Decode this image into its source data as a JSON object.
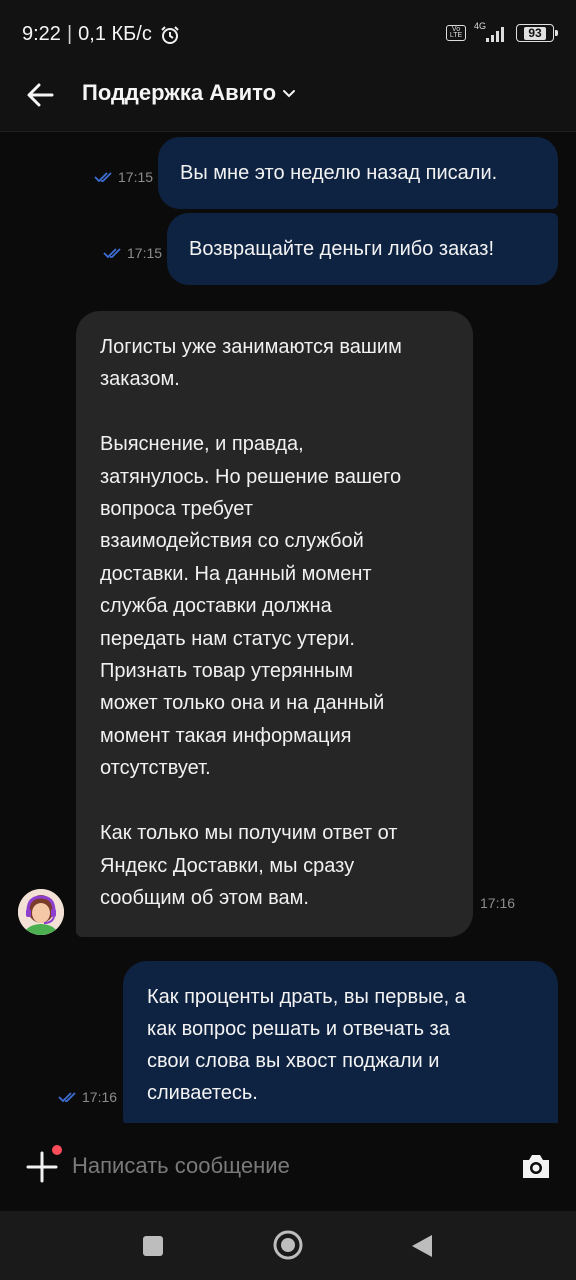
{
  "status_bar": {
    "time": "9:22",
    "speed": "0,1 КБ/с",
    "network": "4G",
    "battery": "93",
    "icons": [
      "alarm-icon",
      "volte-icon",
      "signal-icon",
      "battery-icon"
    ]
  },
  "header": {
    "title": "Поддержка Авито",
    "icons": [
      "back-arrow-icon",
      "chevron-down-icon"
    ]
  },
  "messages": [
    {
      "direction": "out",
      "text": "Вы мне это неделю назад писали.",
      "time": "17:15",
      "status": "read"
    },
    {
      "direction": "out",
      "text": "Возвращайте деньги либо заказ!",
      "time": "17:15",
      "status": "read"
    },
    {
      "direction": "in",
      "text": "Логисты уже занимаются вашим\nзаказом.\n\nВыяснение, и правда,\nзатянулось. Но решение вашего\nвопроса требует\nвзаимодействия со службой\nдоставки. На данный момент\nслужба доставки должна\nпередать нам статус утери.\nПризнать товар утерянным\nможет только она и на данный\nмомент такая информация\nотсутствует.\n\nКак только мы получим ответ от\nЯндекс Доставки, мы сразу\nсообщим об этом вам.",
      "time": "17:16"
    },
    {
      "direction": "out",
      "text": "Как проценты драть, вы первые, а\nкак вопрос решать и отвечать за\nсвои слова вы хвост поджали и\nсливаетесь.",
      "time": "17:16",
      "status": "read"
    }
  ],
  "composer": {
    "placeholder": "Написать сообщение",
    "value": "",
    "icons": [
      "plus-icon",
      "camera-icon"
    ],
    "notification_dot_color": "#ff4d5a"
  },
  "nav_bar": {
    "icons": [
      "recent-apps-icon",
      "home-icon",
      "back-icon"
    ]
  },
  "colors": {
    "background": "#0b0b0b",
    "outgoing_bubble": "#0e2342",
    "incoming_bubble": "#262626",
    "read_check": "#3d6fd6"
  }
}
